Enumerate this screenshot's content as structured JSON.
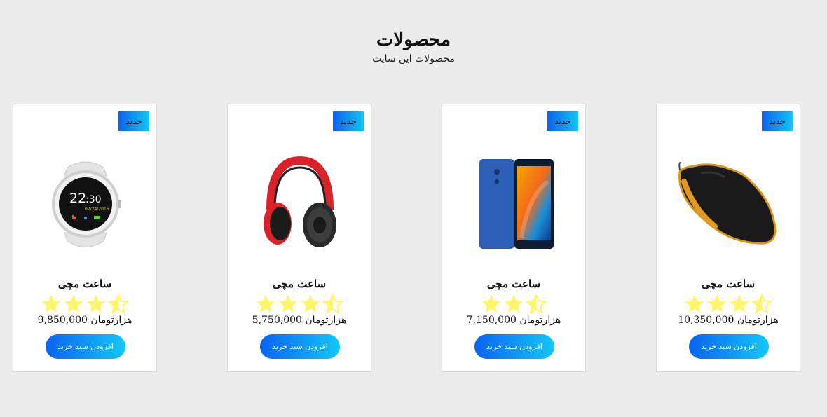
{
  "header": {
    "title": "محصولات",
    "subtitle": "محصولات این سایت"
  },
  "theme": {
    "background": "#ececec",
    "accent_start": "#0a63f0",
    "accent_end": "#14c7f7",
    "star_color": "#fdf56a"
  },
  "products": [
    {
      "badge": "جدید",
      "name": "ساعت مچی",
      "price": "هزارتومان 9,850,000",
      "rating": 3.5,
      "icon": "smartwatch-image",
      "button_label": "افزودن سبد خرید"
    },
    {
      "badge": "جدید",
      "name": "ساعت مچی",
      "price": "هزارتومان 5,750,000",
      "rating": 3.5,
      "icon": "headphones-image",
      "button_label": "افزودن سبد خرید"
    },
    {
      "badge": "جدید",
      "name": "ساعت مچی",
      "price": "هزارتومان 7,150,000",
      "rating": 2.5,
      "icon": "smartphone-image",
      "button_label": "افزودن سبد خرید"
    },
    {
      "badge": "جدید",
      "name": "ساعت مچی",
      "price": "هزارتومان 10,350,000",
      "rating": 3.5,
      "icon": "gaming-mouse-image",
      "button_label": "افزودن سبد خرید"
    }
  ]
}
